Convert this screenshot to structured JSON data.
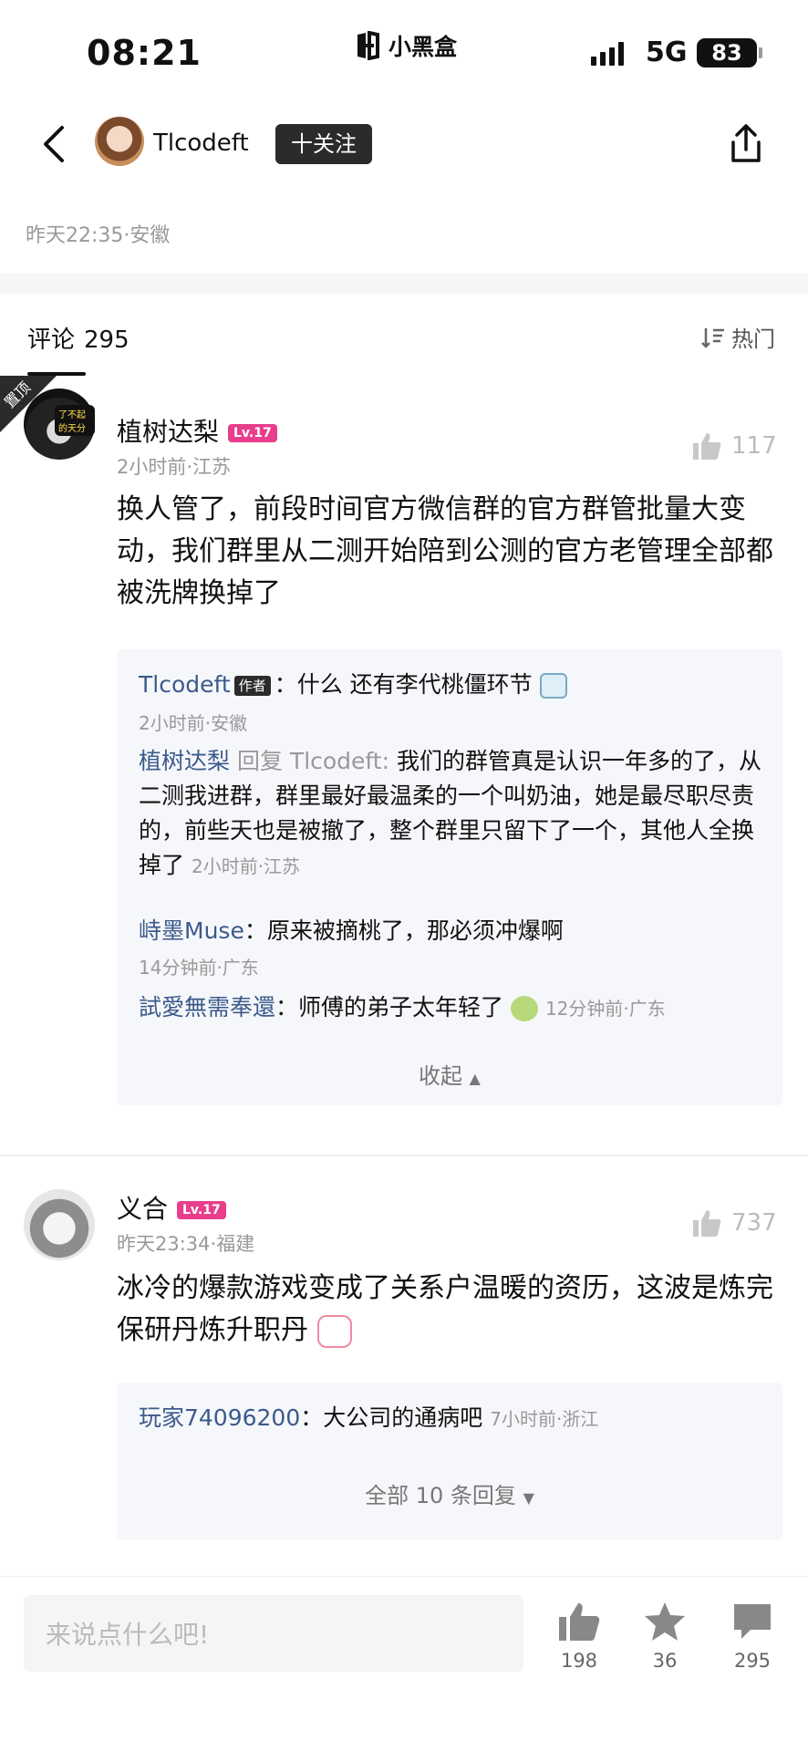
{
  "status": {
    "time": "08:21",
    "brand": "小黑盒",
    "network": "5G",
    "battery": "83"
  },
  "header": {
    "username": "Tlcodeft",
    "follow_label": "十关注"
  },
  "post": {
    "meta": "昨天22:35·安徽"
  },
  "comments_header": {
    "title": "评论",
    "count": "295",
    "sort": "热门"
  },
  "comments": [
    {
      "pinned": true,
      "pin_label": "置顶",
      "avatar_tag": "了不起的天分",
      "name": "植树达梨",
      "level": "Lv.17",
      "meta": "2小时前·江苏",
      "likes": "117",
      "body": "换人管了，前段时间官方微信群的官方群管批量大变动，我们群里从二测开始陪到公测的官方老管理全部都被洗牌换掉了",
      "replies": [
        {
          "name": "Tlcodeft",
          "tag": "作者",
          "text": "：什么 还有李代桃僵环节",
          "meta": "2小时前·安徽"
        },
        {
          "name": "植树达梨",
          "reply_word": " 回复 ",
          "target": "Tlcodeft:",
          "text": " 我们的群管真是认识一年多的了，从二测我进群，群里最好最温柔的一个叫奶油，她是最尽职尽责的，前些天也是被撤了，整个群里只留下了一个，其他人全换掉了",
          "meta": "2小时前·江苏"
        },
        {
          "name": "峙墨Muse",
          "text": "：原来被摘桃了，那必须冲爆啊",
          "meta": "14分钟前·广东"
        },
        {
          "name": "試愛無需奉還",
          "text": "：师傅的弟子太年轻了",
          "meta": "12分钟前·广东"
        }
      ],
      "collapse_label": "收起"
    },
    {
      "pinned": false,
      "name": "义合",
      "level": "Lv.17",
      "meta": "昨天23:34·福建",
      "likes": "737",
      "body": "冰冷的爆款游戏变成了关系户温暖的资历，这波是炼完保研丹炼升职丹",
      "replies": [
        {
          "name": "玩家74096200",
          "text": "：大公司的通病吧",
          "meta": "7小时前·浙江"
        }
      ],
      "more_label": "全部 10 条回复"
    }
  ],
  "bottom": {
    "placeholder": "来说点什么吧!",
    "likes": "198",
    "stars": "36",
    "comments": "295"
  }
}
